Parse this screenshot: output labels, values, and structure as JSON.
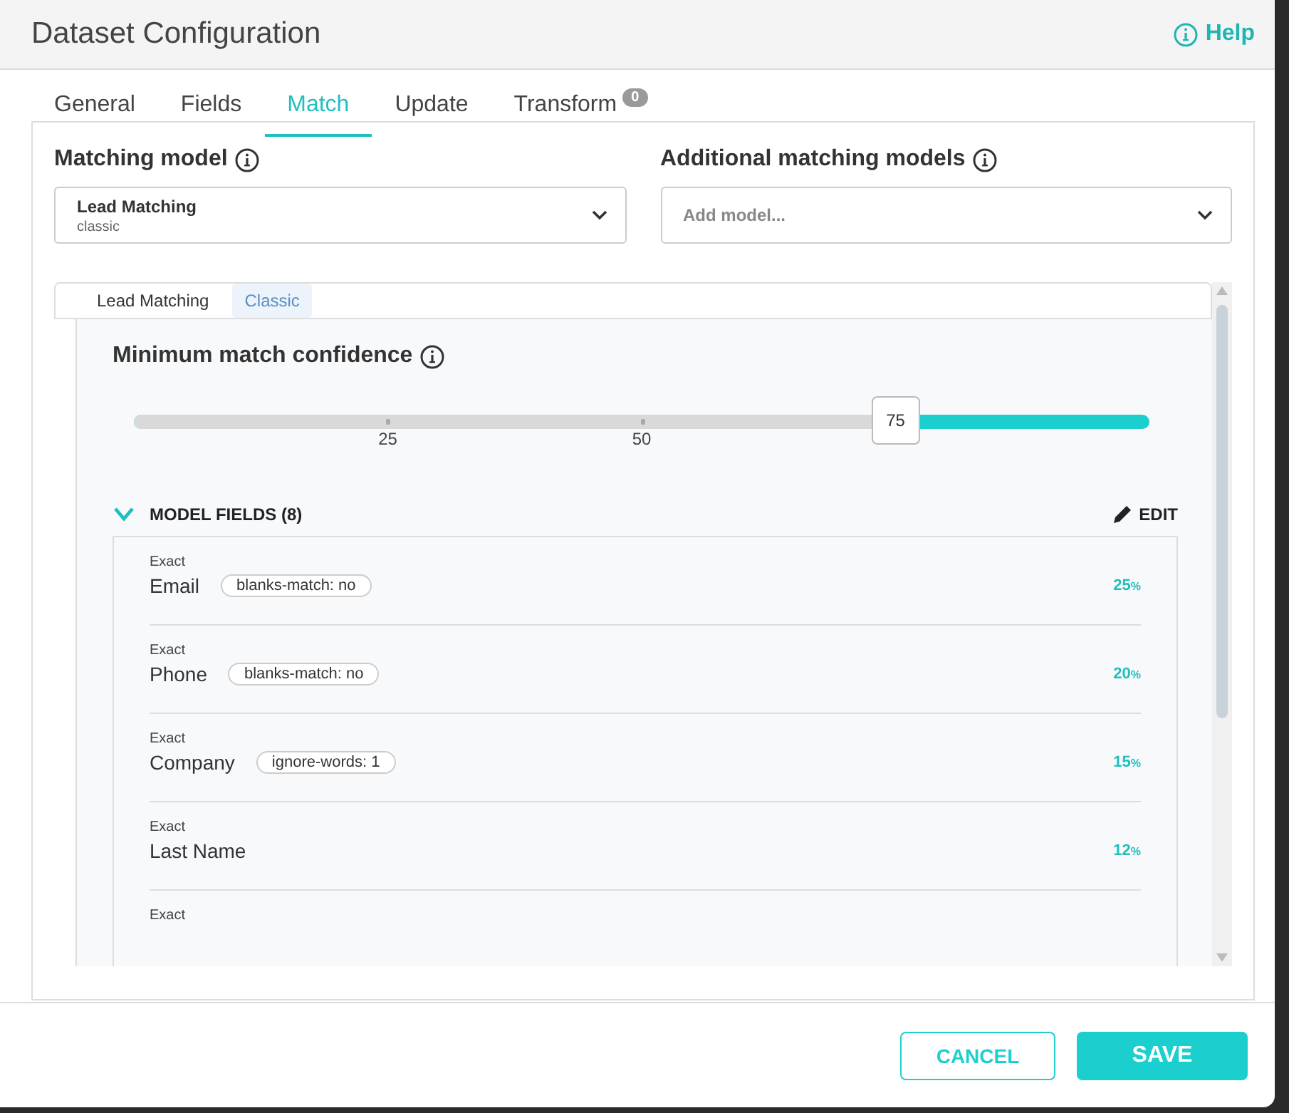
{
  "dialog": {
    "title": "Dataset Configuration",
    "help": "Help"
  },
  "tabs": [
    {
      "label": "General",
      "selected": false
    },
    {
      "label": "Fields",
      "selected": false
    },
    {
      "label": "Match",
      "selected": true
    },
    {
      "label": "Update",
      "selected": false
    },
    {
      "label": "Transform",
      "selected": false,
      "badge": "0"
    }
  ],
  "matching_model": {
    "label": "Matching model",
    "value": "Lead Matching",
    "subvalue": "classic"
  },
  "additional_models": {
    "label": "Additional matching models",
    "placeholder": "Add model..."
  },
  "model_card": {
    "name": "Lead Matching",
    "tag": "Classic",
    "confidence": {
      "label": "Minimum match confidence",
      "level": 0.75,
      "reading": "75",
      "ticks": [
        "25",
        "50"
      ]
    },
    "fields_section": {
      "title": "MODEL FIELDS (8)",
      "expanded": true,
      "edit": "EDIT"
    },
    "fields": [
      {
        "method": "Exact",
        "name": "Email",
        "option": "blanks-match: no",
        "weight": "25",
        "unit": "%"
      },
      {
        "method": "Exact",
        "name": "Phone",
        "option": "blanks-match: no",
        "weight": "20",
        "unit": "%"
      },
      {
        "method": "Exact",
        "name": "Company",
        "option": "ignore-words: 1",
        "weight": "15",
        "unit": "%"
      },
      {
        "method": "Exact",
        "name": "Last Name",
        "weight": "12",
        "unit": "%"
      },
      {
        "method": "Exact"
      }
    ]
  },
  "buttons": [
    {
      "label": "CANCEL",
      "kind": "secondary"
    },
    {
      "label": "SAVE",
      "kind": "primary"
    }
  ]
}
